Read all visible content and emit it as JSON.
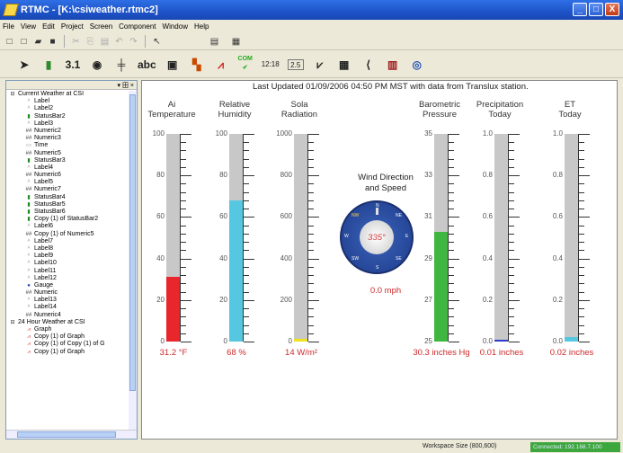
{
  "window": {
    "title": "RTMC - [K:\\csiweather.rtmc2]",
    "controls": [
      "_",
      "□",
      "X"
    ]
  },
  "menu": [
    "File",
    "View",
    "Edit",
    "Project",
    "Screen",
    "Component",
    "Window",
    "Help"
  ],
  "toolbar2": {
    "numeric_label": "3.1",
    "text_label": "abc",
    "table_label": "12:18",
    "table2_label": "2.5",
    "com_label": "COM"
  },
  "tree": {
    "header": "▾ 田 ×",
    "items": [
      {
        "label": "Current Weather at CSI",
        "kind": "screen",
        "indent": 0
      },
      {
        "label": "Label",
        "kind": "label",
        "indent": 2
      },
      {
        "label": "Label2",
        "kind": "label",
        "indent": 2
      },
      {
        "label": "StatusBar2",
        "kind": "statusbar",
        "indent": 2
      },
      {
        "label": "Label3",
        "kind": "label",
        "indent": 2
      },
      {
        "label": "Numeric2",
        "kind": "numeric",
        "indent": 2
      },
      {
        "label": "Numeric3",
        "kind": "numeric",
        "indent": 2
      },
      {
        "label": "Time",
        "kind": "time",
        "indent": 2
      },
      {
        "label": "Numeric5",
        "kind": "numeric",
        "indent": 2
      },
      {
        "label": "StatusBar3",
        "kind": "statusbar",
        "indent": 2
      },
      {
        "label": "Label4",
        "kind": "label",
        "indent": 2
      },
      {
        "label": "Numeric6",
        "kind": "numeric",
        "indent": 2
      },
      {
        "label": "Label5",
        "kind": "label",
        "indent": 2
      },
      {
        "label": "Numeric7",
        "kind": "numeric",
        "indent": 2
      },
      {
        "label": "StatusBar4",
        "kind": "statusbar",
        "indent": 2
      },
      {
        "label": "StatusBar5",
        "kind": "statusbar",
        "indent": 2
      },
      {
        "label": "StatusBar6",
        "kind": "statusbar",
        "indent": 2
      },
      {
        "label": "Copy (1) of StatusBar2",
        "kind": "statusbar",
        "indent": 2
      },
      {
        "label": "Label6",
        "kind": "label",
        "indent": 2
      },
      {
        "label": "Copy (1) of Numeric5",
        "kind": "numeric",
        "indent": 2
      },
      {
        "label": "Label7",
        "kind": "label",
        "indent": 2
      },
      {
        "label": "Label8",
        "kind": "label",
        "indent": 2
      },
      {
        "label": "Label9",
        "kind": "label",
        "indent": 2
      },
      {
        "label": "Label10",
        "kind": "label",
        "indent": 2
      },
      {
        "label": "Label11",
        "kind": "label",
        "indent": 2
      },
      {
        "label": "Label12",
        "kind": "label",
        "indent": 2
      },
      {
        "label": "Gauge",
        "kind": "gauge",
        "indent": 2
      },
      {
        "label": "Numeric",
        "kind": "numeric",
        "indent": 2
      },
      {
        "label": "Label13",
        "kind": "label",
        "indent": 2
      },
      {
        "label": "Label14",
        "kind": "label",
        "indent": 2
      },
      {
        "label": "Numeric4",
        "kind": "numeric",
        "indent": 2
      },
      {
        "label": "24 Hour Weather at CSI",
        "kind": "screen",
        "indent": 0
      },
      {
        "label": "Graph",
        "kind": "graph",
        "indent": 2
      },
      {
        "label": "Copy (1) of Graph",
        "kind": "graph",
        "indent": 2
      },
      {
        "label": "Copy (1) of Copy (1) of G",
        "kind": "graph",
        "indent": 2
      },
      {
        "label": "Copy (1) of Graph",
        "kind": "graph",
        "indent": 2
      }
    ]
  },
  "canvas": {
    "last_updated": "Last Updated 01/09/2006 04:50 PM MST with data from Translux station.",
    "wind": {
      "title_line1": "Wind Direction",
      "title_line2": "and Speed",
      "direction_deg_label": "335°",
      "direction_deg": 335,
      "speed_label": "0.0 mph",
      "compass_points": [
        "N",
        "NE",
        "E",
        "SE",
        "S",
        "SW",
        "W",
        "NW"
      ]
    },
    "gauges": [
      {
        "label_l1": "Ai",
        "label_l2": "Temperature",
        "min": 0,
        "max": 100,
        "ticks": [
          "100",
          "80",
          "60",
          "40",
          "20",
          "0"
        ],
        "value": 31.2,
        "value_label": "31.2 °F",
        "color": "#e8262b"
      },
      {
        "label_l1": "Relative",
        "label_l2": "Humidity",
        "min": 0,
        "max": 100,
        "ticks": [
          "100",
          "80",
          "60",
          "40",
          "20",
          "0"
        ],
        "value": 68,
        "value_label": "68 %",
        "color": "#56c7e0"
      },
      {
        "label_l1": "Sola",
        "label_l2": "Radiation",
        "min": 0,
        "max": 1000,
        "ticks": [
          "1000",
          "800",
          "600",
          "400",
          "200",
          "0"
        ],
        "value": 14,
        "value_label": "14 W/m²",
        "color": "#f0e21e"
      },
      {
        "label_l1": "Barometric",
        "label_l2": "Pressure",
        "min": 25,
        "max": 35,
        "ticks": [
          "35",
          "33",
          "31",
          "29",
          "27",
          "25"
        ],
        "value": 30.3,
        "value_label": "30.3 inches Hg",
        "color": "#3fb63f"
      },
      {
        "label_l1": "Precipitation",
        "label_l2": "Today",
        "min": 0,
        "max": 1,
        "ticks": [
          "1.0",
          "0.8",
          "0.6",
          "0.4",
          "0.2",
          "0.0"
        ],
        "value": 0.01,
        "value_label": "0.01 inches",
        "color": "#2b3ec9"
      },
      {
        "label_l1": "ET",
        "label_l2": "Today",
        "min": 0,
        "max": 1,
        "ticks": [
          "1.0",
          "0.8",
          "0.6",
          "0.4",
          "0.2",
          "0.0"
        ],
        "value": 0.02,
        "value_label": "0.02 inches",
        "color": "#56c7e0"
      }
    ]
  },
  "status": {
    "workspace": "Workspace Size (800,600)",
    "connection": "Connected: 192.168.7.100"
  }
}
